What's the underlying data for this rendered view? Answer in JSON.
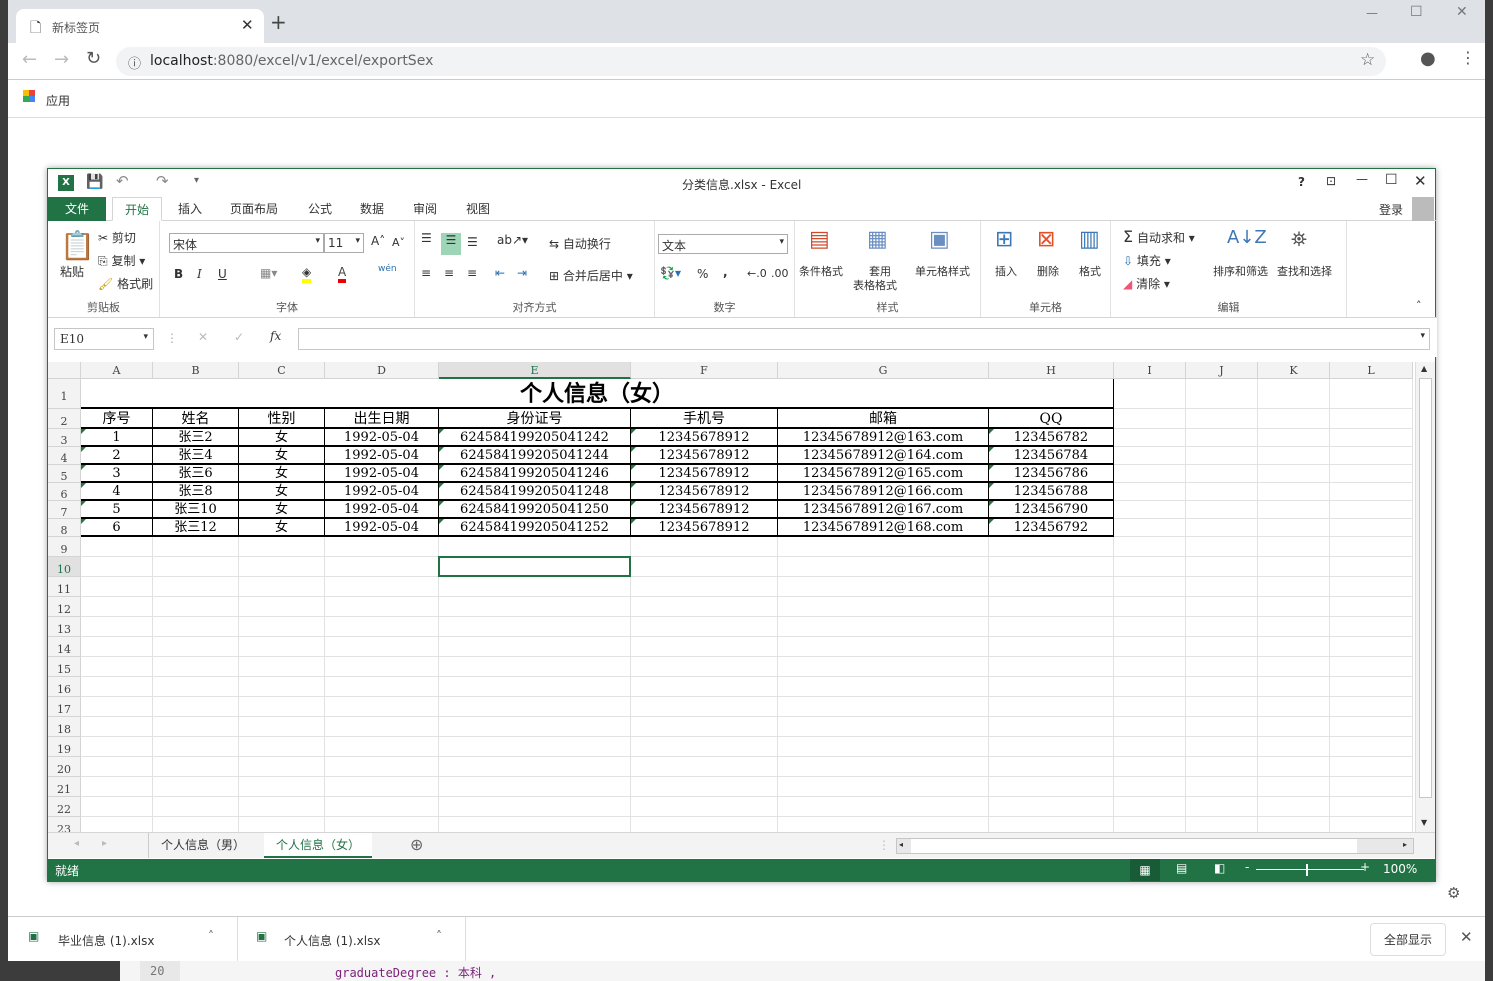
{
  "browser": {
    "tab_title": "新标签页",
    "url_host": "localhost",
    "url_path": ":8080/excel/v1/excel/exportSex",
    "bookmark_apps": "应用"
  },
  "excel": {
    "title": "分类信息.xlsx - Excel",
    "login": "登录",
    "tabs": [
      "文件",
      "开始",
      "插入",
      "页面布局",
      "公式",
      "数据",
      "审阅",
      "视图"
    ],
    "active_tab": "开始",
    "clipboard": {
      "paste": "粘贴",
      "cut": "剪切",
      "copy": "复制",
      "format_painter": "格式刷",
      "label": "剪贴板"
    },
    "font": {
      "name": "宋体",
      "size": "11",
      "label": "字体",
      "bold": "B",
      "italic": "I",
      "underline": "U",
      "phonetic": "wén"
    },
    "alignment": {
      "wrap": "自动换行",
      "merge": "合并后居中",
      "label": "对齐方式"
    },
    "number": {
      "format": "文本",
      "percent": "%",
      "comma": ",",
      "label": "数字"
    },
    "styles": {
      "conditional": "条件格式",
      "table1": "套用",
      "table2": "表格格式",
      "cell_styles": "单元格样式",
      "label": "样式"
    },
    "cells": {
      "insert": "插入",
      "delete": "删除",
      "format": "格式",
      "label": "单元格"
    },
    "editing": {
      "autosum": "自动求和",
      "fill": "填充",
      "clear": "清除",
      "sort": "排序和筛选",
      "find": "查找和选择",
      "label": "编辑"
    },
    "name_box": "E10",
    "formula": "",
    "columns": [
      "A",
      "B",
      "C",
      "D",
      "E",
      "F",
      "G",
      "H",
      "I",
      "J",
      "K",
      "L"
    ],
    "selected_column": "E",
    "selected_row": 10,
    "sheet_title": "个人信息（女）",
    "headers": [
      "序号",
      "姓名",
      "性别",
      "出生日期",
      "身份证号",
      "手机号",
      "邮箱",
      "QQ"
    ],
    "rows": [
      [
        "1",
        "张三2",
        "女",
        "1992-05-04",
        "624584199205041242",
        "12345678912",
        "12345678912@163.com",
        "123456782"
      ],
      [
        "2",
        "张三4",
        "女",
        "1992-05-04",
        "624584199205041244",
        "12345678912",
        "12345678912@164.com",
        "123456784"
      ],
      [
        "3",
        "张三6",
        "女",
        "1992-05-04",
        "624584199205041246",
        "12345678912",
        "12345678912@165.com",
        "123456786"
      ],
      [
        "4",
        "张三8",
        "女",
        "1992-05-04",
        "624584199205041248",
        "12345678912",
        "12345678912@166.com",
        "123456788"
      ],
      [
        "5",
        "张三10",
        "女",
        "1992-05-04",
        "624584199205041250",
        "12345678912",
        "12345678912@167.com",
        "123456790"
      ],
      [
        "6",
        "张三12",
        "女",
        "1992-05-04",
        "624584199205041252",
        "12345678912",
        "12345678912@168.com",
        "123456792"
      ]
    ],
    "sheets": [
      "个人信息（男）",
      "个人信息（女）"
    ],
    "active_sheet": 1,
    "status": "就绪",
    "zoom": "100%",
    "accent": "#217346"
  },
  "downloads": {
    "items": [
      "毕业信息 (1).xlsx",
      "个人信息 (1).xlsx"
    ],
    "show_all": "全部显示"
  },
  "background_code": {
    "line_no": "20",
    "text": "graduateDegree : 本科 ,"
  }
}
